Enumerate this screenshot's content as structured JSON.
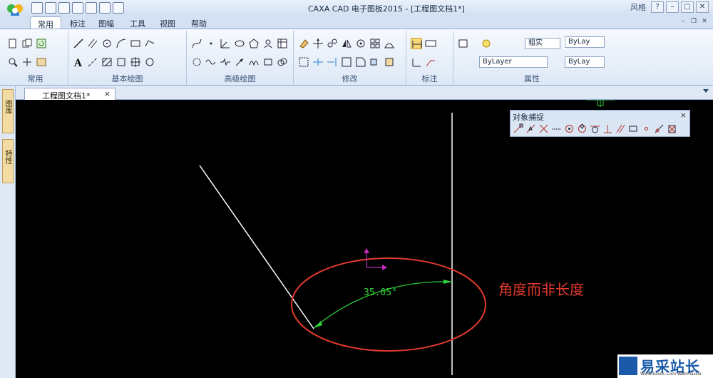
{
  "titlebar": {
    "title": "CAXA CAD 电子图板2015 - [工程图文档1*]",
    "style_label": "风格",
    "controls": [
      "–",
      "□",
      "✕"
    ]
  },
  "ribbon_tabs": [
    "常用",
    "标注",
    "图幅",
    "工具",
    "视图",
    "帮助"
  ],
  "active_tab": "常用",
  "ribbon_groups": [
    "常用",
    "基本绘图",
    "高级绘图",
    "修改",
    "标注",
    "属性"
  ],
  "properties": {
    "layer_name": "粗实",
    "color": "ByLay",
    "linetype": "ByLayer",
    "lineweight": "ByLay"
  },
  "document": {
    "tab_label": "工程图文档1*",
    "close": "×"
  },
  "side_tabs": [
    "图库",
    "特性"
  ],
  "snap_panel": {
    "title": "对象捕捉",
    "close": "×"
  },
  "drawing": {
    "angle_dimension": "35.05°",
    "annotation": "角度而非长度"
  },
  "watermark": {
    "text": "易采站长站",
    "sub": "Www.Easck.Com Webmaster"
  },
  "colors": {
    "canvas": "#000000",
    "dimension": "#2fcf3a",
    "highlight_ellipse": "#e23a2d",
    "ucs": "#c02cc0"
  }
}
